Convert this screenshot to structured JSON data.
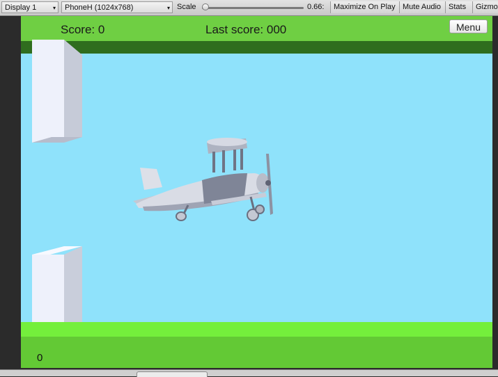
{
  "toolbar": {
    "display_label": "Display 1",
    "resolution_label": "PhoneH (1024x768)",
    "scale_label": "Scale",
    "scale_value": "0.66:",
    "scale_fraction": 0.02,
    "maximize_label": "Maximize On Play",
    "mute_label": "Mute Audio",
    "stats_label": "Stats",
    "gizmos_label": "Gizmo"
  },
  "game": {
    "score_text": "Score: 0",
    "last_score_text": "Last score:  000",
    "menu_label": "Menu",
    "bottom_counter": "0"
  },
  "colors": {
    "sky": "#8fe2fb",
    "top_bar": "#6fcf43",
    "top_bar_shadow": "#2f6d1e",
    "ground_light": "#74ef3c",
    "ground_dark": "#63c935",
    "pipe": "#eef1fb"
  },
  "icons": {
    "dropdown": "chevron-updown-icon",
    "slider": "slider-thumb-icon"
  }
}
